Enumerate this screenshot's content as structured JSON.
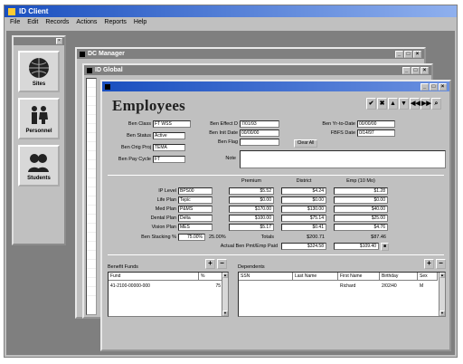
{
  "app": {
    "title": "ID Client"
  },
  "menu": [
    "File",
    "Edit",
    "Records",
    "Actions",
    "Reports",
    "Help"
  ],
  "sidebar": {
    "items": [
      {
        "label": "Sites"
      },
      {
        "label": "Personnel"
      },
      {
        "label": "Students"
      }
    ]
  },
  "windows": {
    "back1_title": "DC Manager",
    "back2_title": "ID Global"
  },
  "employees": {
    "title": "Employees",
    "toolbar": [
      "✔",
      "✖",
      "▲",
      "▼",
      "◀◀",
      "▶▶",
      "⌕"
    ],
    "left_fields": [
      {
        "label": "Ben Class",
        "value": "FT WSS"
      },
      {
        "label": "Ben Status",
        "value": "Active"
      },
      {
        "label": "Ben Orig Proj",
        "value": "TEMA"
      },
      {
        "label": "Ben Pay Cycle",
        "value": "FT"
      }
    ],
    "mid_fields": [
      {
        "label": "Ben Effect D",
        "value": "7/01/93"
      },
      {
        "label": "Ben Init Date",
        "value": "00/00/00"
      },
      {
        "label": "Ben Flag",
        "value": ""
      }
    ],
    "right_fields": [
      {
        "label": "Ben Yr-to-Date",
        "value": "00/00/00"
      },
      {
        "label": "FBFS Date",
        "value": "0/14/97"
      }
    ],
    "clear_all": "Clear All",
    "notes_label": "Note",
    "plan_headers": [
      "Premium",
      "District",
      "Emp (10 Mo)"
    ],
    "plans": [
      {
        "label": "IP Level",
        "value": "BPS00",
        "premium": "$5.52",
        "district": "$4.24",
        "emp": "$1.28"
      },
      {
        "label": "Life Plan",
        "value": "Tepic",
        "premium": "$0.00",
        "district": "$0.00",
        "emp": "$0.00"
      },
      {
        "label": "Med Plan",
        "value": "P&MS",
        "premium": "$170.00",
        "district": "$130.00",
        "emp": "$40.00"
      },
      {
        "label": "Dental Plan",
        "value": "Delta",
        "premium": "$100.00",
        "district": "$75.14",
        "emp": "$25.00"
      },
      {
        "label": "Vision Plan",
        "value": "MES",
        "premium": "$5.17",
        "district": "$0.41",
        "emp": "$4.76"
      }
    ],
    "stacking_label": "Ben Stacking %",
    "stacking_value": "75.00%",
    "stacking_pct2": "25.00%",
    "totals_label": "Totals",
    "totals_district": "$200.71",
    "totals_emp": "$87.46",
    "actual_label": "Actual Ben Pmt/Emp Paid",
    "actual_value": "$324.58",
    "actual_emp": "$109.40",
    "benefit_funds": {
      "title": "Benefit Funds",
      "headers": [
        "Fund",
        "%"
      ],
      "rows": [
        [
          "41-2100-00000-000",
          "75"
        ]
      ]
    },
    "dependents": {
      "title": "Dependents",
      "headers": [
        "SSN",
        "Last Name",
        "First Name",
        "Birthday",
        "Sex"
      ],
      "rows": [
        [
          "",
          "",
          "Richard",
          "2/02/40",
          "M"
        ]
      ]
    }
  }
}
